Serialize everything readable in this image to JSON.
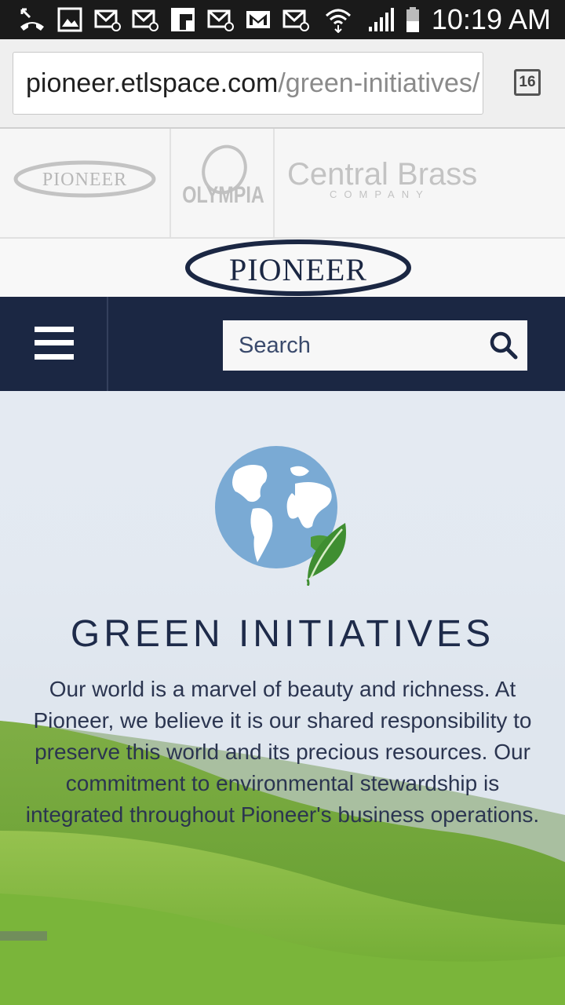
{
  "status_bar": {
    "time": "10:19 AM",
    "icons": [
      "missed-call-icon",
      "gallery-icon",
      "email-icon",
      "email-icon",
      "flipboard-icon",
      "email-icon",
      "gmail-icon",
      "email-icon",
      "wifi-icon",
      "signal-icon",
      "battery-icon"
    ]
  },
  "browser": {
    "url_host": "pioneer.etlspace.com",
    "url_path": "/green-initiatives/",
    "tab_count": "16"
  },
  "brands": {
    "items": [
      "PIONEER",
      "OLYMPIA",
      "Central Brass",
      "COMPANY"
    ]
  },
  "logo": {
    "text": "PIONEER"
  },
  "nav": {
    "search_placeholder": "Search"
  },
  "hero": {
    "title": "GREEN INITIATIVES",
    "body": "Our world is a marvel of beauty and richness. At Pioneer, we believe it is our shared responsibility to preserve this world and its precious resources. Our commitment to environmental stewardship is integrated throughout Pioneer's business operations."
  },
  "colors": {
    "nav_bg": "#1b2743",
    "title": "#1e2b4a",
    "globe": "#7aaad4",
    "leaf": "#4b9a3a"
  }
}
